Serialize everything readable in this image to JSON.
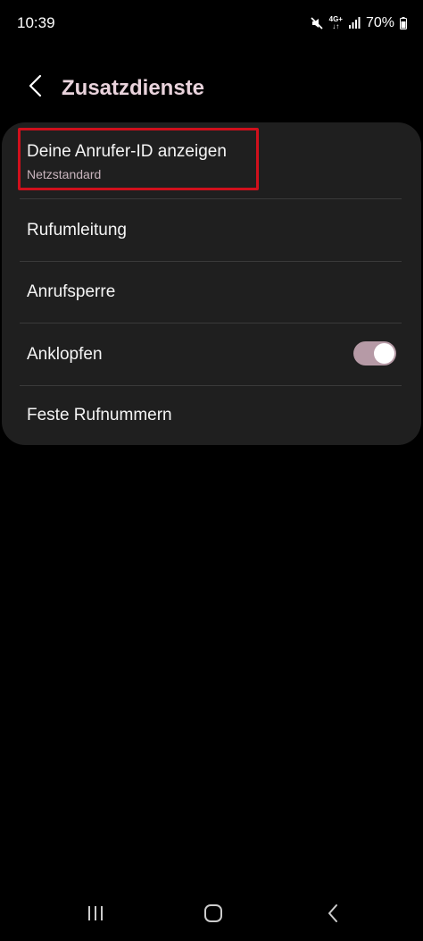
{
  "status_bar": {
    "time": "10:39",
    "network_top": "4G+",
    "network_bottom": "↓↑",
    "battery": "70%",
    "icons": [
      "mute-icon",
      "signal-icon",
      "battery-icon"
    ]
  },
  "header": {
    "title": "Zusatzdienste",
    "back_icon": "chevron-left-icon",
    "title_color": "#e9d3dc"
  },
  "settings": {
    "items": [
      {
        "label": "Deine Anrufer-ID anzeigen",
        "sub": "Netzstandard"
      },
      {
        "label": "Rufumleitung"
      },
      {
        "label": "Anrufsperre"
      },
      {
        "label": "Anklopfen",
        "toggle_on": true
      },
      {
        "label": "Feste Rufnummern"
      }
    ],
    "highlight_color": "#d0101c",
    "toggle_color": "#b69aa6"
  },
  "nav_bar": {
    "icons": [
      "recent-apps-icon",
      "home-icon",
      "back-icon"
    ]
  }
}
